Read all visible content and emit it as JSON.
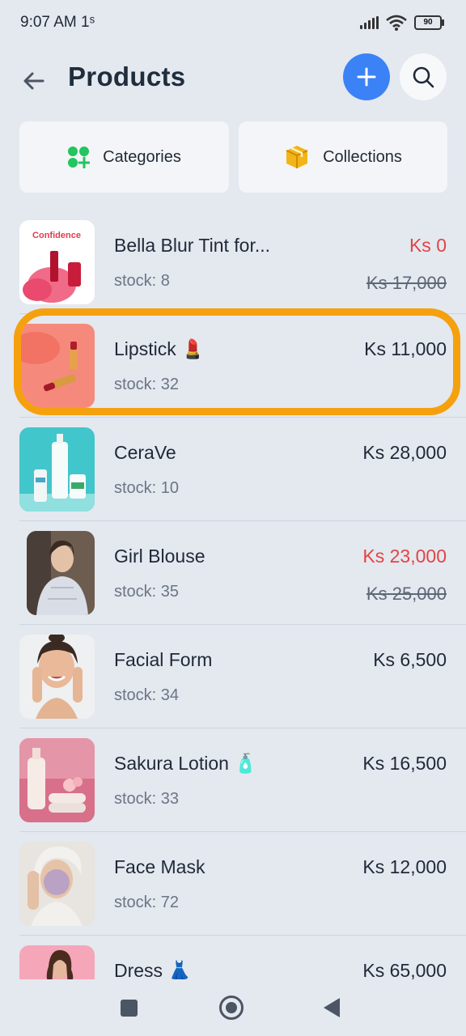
{
  "status_bar": {
    "time": "9:07 AM",
    "time_suffix": "1ˢ",
    "battery": "90"
  },
  "header": {
    "title": "Products"
  },
  "tabs": {
    "categories_label": "Categories",
    "collections_label": "Collections"
  },
  "products": [
    {
      "name": "Bella Blur Tint for...",
      "stock": "stock: 8",
      "price": "Ks 0",
      "old_price": "Ks 17,000",
      "on_sale": true
    },
    {
      "name": "Lipstick 💄",
      "stock": "stock: 32",
      "price": "Ks 11,000",
      "old_price": "",
      "on_sale": false
    },
    {
      "name": "CeraVe",
      "stock": "stock: 10",
      "price": "Ks 28,000",
      "old_price": "",
      "on_sale": false
    },
    {
      "name": "Girl Blouse",
      "stock": "stock: 35",
      "price": "Ks 23,000",
      "old_price": "Ks 25,000",
      "on_sale": true
    },
    {
      "name": "Facial Form",
      "stock": "stock: 34",
      "price": "Ks 6,500",
      "old_price": "",
      "on_sale": false
    },
    {
      "name": "Sakura Lotion 🧴",
      "stock": "stock: 33",
      "price": "Ks 16,500",
      "old_price": "",
      "on_sale": false
    },
    {
      "name": "Face Mask",
      "stock": "stock: 72",
      "price": "Ks 12,000",
      "old_price": "",
      "on_sale": false
    },
    {
      "name": "Dress 👗",
      "stock": "",
      "price": "Ks 65,000",
      "old_price": "",
      "on_sale": false
    }
  ],
  "thumb_banner_text": "Confidence",
  "colors": {
    "accent": "#3b82f6",
    "sale": "#e04545",
    "highlight": "#f5a10e",
    "categories_icon": "#22c55e",
    "collections_icon": "#f2b418"
  },
  "icons": {
    "back": "arrow-left-icon",
    "add": "plus-icon",
    "search": "search-icon",
    "categories": "categories-icon",
    "collections": "box-icon"
  }
}
